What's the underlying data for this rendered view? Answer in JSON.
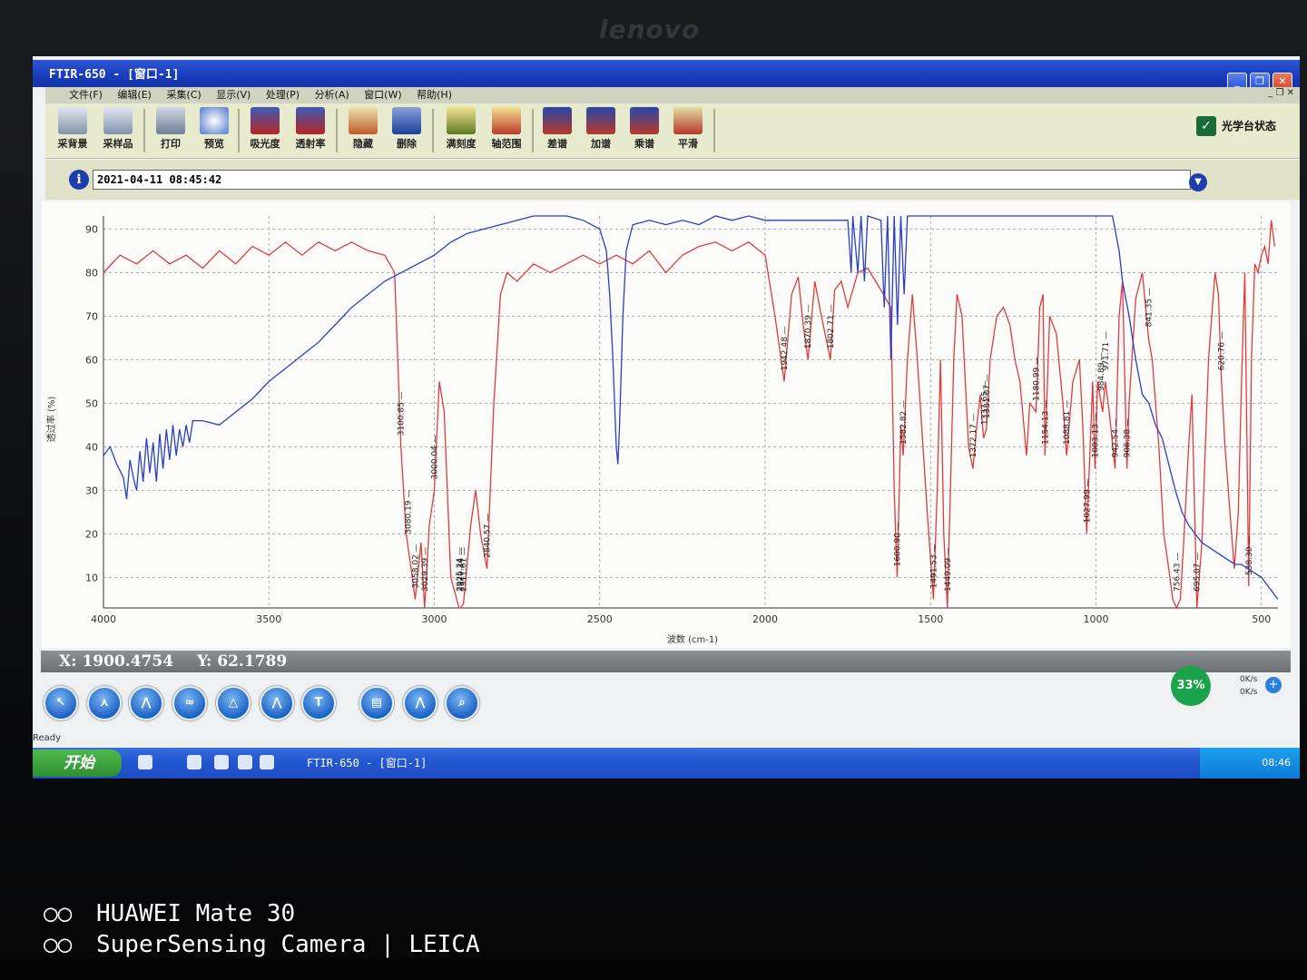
{
  "monitor": {
    "brand": "lenovo"
  },
  "window": {
    "title": "FTIR-650 - [窗口-1]"
  },
  "menu": [
    "文件(F)",
    "编辑(E)",
    "采集(C)",
    "显示(V)",
    "处理(P)",
    "分析(A)",
    "窗口(W)",
    "帮助(H)"
  ],
  "toolbar": {
    "buttons": [
      "采背景",
      "采样品",
      "打印",
      "预览",
      "吸光度",
      "透射率",
      "隐藏",
      "删除",
      "满刻度",
      "轴范围",
      "差谱",
      "加谱",
      "乘谱",
      "平滑"
    ],
    "online_label": "光学台状态"
  },
  "info": {
    "timestamp": "2021-04-11 08:45:42"
  },
  "chart_data": {
    "type": "line",
    "xlabel": "波数 (cm-1)",
    "ylabel": "透过率 (%)",
    "xlim": [
      4000,
      450
    ],
    "ylim": [
      3,
      93
    ],
    "x_ticks": [
      4000,
      3500,
      3000,
      2500,
      2000,
      1500,
      1000,
      500
    ],
    "y_ticks": [
      10,
      20,
      30,
      40,
      50,
      60,
      70,
      80,
      90
    ],
    "grid": true,
    "series": [
      {
        "color": "#e03b3b",
        "points": [
          [
            4000,
            80
          ],
          [
            3950,
            84
          ],
          [
            3900,
            82
          ],
          [
            3850,
            85
          ],
          [
            3800,
            82
          ],
          [
            3750,
            84
          ],
          [
            3700,
            81
          ],
          [
            3650,
            85
          ],
          [
            3600,
            82
          ],
          [
            3550,
            86
          ],
          [
            3500,
            84
          ],
          [
            3450,
            87
          ],
          [
            3400,
            84
          ],
          [
            3350,
            87
          ],
          [
            3300,
            85
          ],
          [
            3250,
            87
          ],
          [
            3200,
            85
          ],
          [
            3150,
            84
          ],
          [
            3120,
            80
          ],
          [
            3100.85,
            40
          ],
          [
            3085,
            20
          ],
          [
            3070,
            12
          ],
          [
            3058.02,
            5
          ],
          [
            3040,
            18
          ],
          [
            3029.39,
            3
          ],
          [
            3015,
            22
          ],
          [
            3000.04,
            30
          ],
          [
            2985,
            55
          ],
          [
            2970,
            48
          ],
          [
            2950,
            10
          ],
          [
            2925,
            3
          ],
          [
            2920.34,
            3
          ],
          [
            2911.61,
            4
          ],
          [
            2890,
            22
          ],
          [
            2875,
            30
          ],
          [
            2860,
            20
          ],
          [
            2840.57,
            12
          ],
          [
            2820,
            50
          ],
          [
            2800,
            75
          ],
          [
            2780,
            80
          ],
          [
            2750,
            78
          ],
          [
            2700,
            82
          ],
          [
            2650,
            80
          ],
          [
            2600,
            82
          ],
          [
            2550,
            84
          ],
          [
            2500,
            82
          ],
          [
            2450,
            84
          ],
          [
            2400,
            82
          ],
          [
            2350,
            85
          ],
          [
            2300,
            80
          ],
          [
            2250,
            84
          ],
          [
            2200,
            86
          ],
          [
            2150,
            87
          ],
          [
            2100,
            85
          ],
          [
            2050,
            87
          ],
          [
            2000,
            84
          ],
          [
            1970,
            70
          ],
          [
            1942.48,
            55
          ],
          [
            1920,
            75
          ],
          [
            1900,
            79
          ],
          [
            1885,
            68
          ],
          [
            1870.39,
            60
          ],
          [
            1850,
            78
          ],
          [
            1830,
            70
          ],
          [
            1802.71,
            60
          ],
          [
            1790,
            76
          ],
          [
            1770,
            78
          ],
          [
            1750,
            72
          ],
          [
            1720,
            80
          ],
          [
            1690,
            81
          ],
          [
            1650,
            76
          ],
          [
            1620,
            72
          ],
          [
            1610,
            30
          ],
          [
            1600.9,
            10
          ],
          [
            1590,
            45
          ],
          [
            1582.82,
            38
          ],
          [
            1570,
            60
          ],
          [
            1555,
            75
          ],
          [
            1540,
            60
          ],
          [
            1510,
            25
          ],
          [
            1491.53,
            5
          ],
          [
            1480,
            30
          ],
          [
            1470,
            60
          ],
          [
            1460,
            20
          ],
          [
            1449.09,
            3
          ],
          [
            1430,
            60
          ],
          [
            1420,
            75
          ],
          [
            1405,
            70
          ],
          [
            1385,
            40
          ],
          [
            1372.17,
            35
          ],
          [
            1360,
            45
          ],
          [
            1350,
            52
          ],
          [
            1340,
            42
          ],
          [
            1331.07,
            44
          ],
          [
            1320,
            60
          ],
          [
            1300,
            70
          ],
          [
            1280,
            72
          ],
          [
            1260,
            68
          ],
          [
            1245,
            60
          ],
          [
            1230,
            55
          ],
          [
            1210,
            38
          ],
          [
            1200,
            50
          ],
          [
            1180.99,
            48
          ],
          [
            1170,
            72
          ],
          [
            1160,
            75
          ],
          [
            1154.13,
            38
          ],
          [
            1140,
            70
          ],
          [
            1120,
            66
          ],
          [
            1100,
            50
          ],
          [
            1088.81,
            38
          ],
          [
            1070,
            55
          ],
          [
            1050,
            60
          ],
          [
            1040,
            45
          ],
          [
            1027.99,
            20
          ],
          [
            1010,
            55
          ],
          [
            1003.13,
            35
          ],
          [
            995,
            55
          ],
          [
            980,
            48
          ],
          [
            971.71,
            55
          ],
          [
            960,
            48
          ],
          [
            942.54,
            35
          ],
          [
            930,
            70
          ],
          [
            920,
            78
          ],
          [
            906.38,
            35
          ],
          [
            900,
            50
          ],
          [
            880,
            74
          ],
          [
            860,
            80
          ],
          [
            841.35,
            65
          ],
          [
            830,
            60
          ],
          [
            810,
            40
          ],
          [
            795,
            20
          ],
          [
            780,
            12
          ],
          [
            768,
            5
          ],
          [
            756.43,
            3
          ],
          [
            745,
            5
          ],
          [
            735,
            18
          ],
          [
            720,
            40
          ],
          [
            710,
            52
          ],
          [
            695.07,
            3
          ],
          [
            680,
            18
          ],
          [
            660,
            60
          ],
          [
            640,
            80
          ],
          [
            630,
            75
          ],
          [
            620.76,
            55
          ],
          [
            610,
            40
          ],
          [
            595,
            25
          ],
          [
            582,
            12
          ],
          [
            570,
            25
          ],
          [
            560,
            55
          ],
          [
            550,
            80
          ],
          [
            538.3,
            8
          ],
          [
            530,
            60
          ],
          [
            520,
            82
          ],
          [
            510,
            80
          ],
          [
            500,
            84
          ],
          [
            490,
            86
          ],
          [
            480,
            82
          ],
          [
            470,
            92
          ],
          [
            460,
            86
          ]
        ]
      },
      {
        "color": "#2b3fc6",
        "points": [
          [
            4000,
            38
          ],
          [
            3980,
            40
          ],
          [
            3960,
            36
          ],
          [
            3940,
            33
          ],
          [
            3930,
            28
          ],
          [
            3920,
            37
          ],
          [
            3910,
            33
          ],
          [
            3900,
            30
          ],
          [
            3890,
            39
          ],
          [
            3880,
            32
          ],
          [
            3870,
            42
          ],
          [
            3860,
            34
          ],
          [
            3850,
            41
          ],
          [
            3840,
            32
          ],
          [
            3830,
            43
          ],
          [
            3820,
            35
          ],
          [
            3810,
            44
          ],
          [
            3800,
            37
          ],
          [
            3790,
            45
          ],
          [
            3780,
            38
          ],
          [
            3770,
            44
          ],
          [
            3760,
            40
          ],
          [
            3750,
            45
          ],
          [
            3740,
            41
          ],
          [
            3730,
            46
          ],
          [
            3700,
            46
          ],
          [
            3650,
            45
          ],
          [
            3600,
            48
          ],
          [
            3550,
            51
          ],
          [
            3500,
            55
          ],
          [
            3450,
            58
          ],
          [
            3400,
            61
          ],
          [
            3350,
            64
          ],
          [
            3300,
            68
          ],
          [
            3250,
            72
          ],
          [
            3200,
            75
          ],
          [
            3150,
            78
          ],
          [
            3100,
            80
          ],
          [
            3050,
            82
          ],
          [
            3000,
            84
          ],
          [
            2950,
            87
          ],
          [
            2900,
            89
          ],
          [
            2800,
            91
          ],
          [
            2700,
            93
          ],
          [
            2600,
            93
          ],
          [
            2550,
            92
          ],
          [
            2500,
            90
          ],
          [
            2480,
            85
          ],
          [
            2470,
            75
          ],
          [
            2460,
            60
          ],
          [
            2450,
            40
          ],
          [
            2445,
            36
          ],
          [
            2440,
            45
          ],
          [
            2430,
            70
          ],
          [
            2420,
            85
          ],
          [
            2400,
            91
          ],
          [
            2350,
            92
          ],
          [
            2300,
            91
          ],
          [
            2250,
            92
          ],
          [
            2200,
            91
          ],
          [
            2150,
            93
          ],
          [
            2100,
            92
          ],
          [
            2050,
            93
          ],
          [
            2000,
            92
          ],
          [
            1900,
            92
          ],
          [
            1800,
            92
          ],
          [
            1750,
            92
          ],
          [
            1740,
            80
          ],
          [
            1735,
            93
          ],
          [
            1720,
            80
          ],
          [
            1710,
            93
          ],
          [
            1700,
            78
          ],
          [
            1690,
            93
          ],
          [
            1650,
            92
          ],
          [
            1640,
            72
          ],
          [
            1630,
            93
          ],
          [
            1620,
            60
          ],
          [
            1610,
            93
          ],
          [
            1600,
            68
          ],
          [
            1590,
            93
          ],
          [
            1580,
            75
          ],
          [
            1570,
            93
          ],
          [
            1500,
            93
          ],
          [
            1400,
            93
          ],
          [
            1300,
            93
          ],
          [
            1200,
            93
          ],
          [
            1100,
            93
          ],
          [
            1000,
            93
          ],
          [
            950,
            93
          ],
          [
            930,
            85
          ],
          [
            920,
            78
          ],
          [
            900,
            70
          ],
          [
            880,
            60
          ],
          [
            860,
            52
          ],
          [
            840,
            50
          ],
          [
            820,
            45
          ],
          [
            800,
            42
          ],
          [
            780,
            36
          ],
          [
            760,
            30
          ],
          [
            740,
            25
          ],
          [
            720,
            22
          ],
          [
            700,
            20
          ],
          [
            680,
            18
          ],
          [
            660,
            17
          ],
          [
            640,
            16
          ],
          [
            620,
            15
          ],
          [
            600,
            14
          ],
          [
            580,
            13
          ],
          [
            560,
            13
          ],
          [
            540,
            12
          ],
          [
            520,
            11
          ],
          [
            500,
            10
          ],
          [
            480,
            8
          ],
          [
            460,
            6
          ],
          [
            450,
            5
          ]
        ]
      }
    ],
    "peak_labels": [
      {
        "x": 3100.85,
        "label": "3100.85"
      },
      {
        "x": 3080.19,
        "label": "3080.19"
      },
      {
        "x": 3058.02,
        "label": "3058.02"
      },
      {
        "x": 3029.39,
        "label": "3029.39"
      },
      {
        "x": 3000.04,
        "label": "3000.04"
      },
      {
        "x": 2925.24,
        "label": "2925.24"
      },
      {
        "x": 2920.34,
        "label": "2920.34"
      },
      {
        "x": 2911.61,
        "label": "2911.61"
      },
      {
        "x": 2840.57,
        "label": "2840.57"
      },
      {
        "x": 1942.48,
        "label": "1942.48"
      },
      {
        "x": 1870.39,
        "label": "1870.39"
      },
      {
        "x": 1802.71,
        "label": "1802.71"
      },
      {
        "x": 1600.9,
        "label": "1600.90"
      },
      {
        "x": 1582.82,
        "label": "1582.82"
      },
      {
        "x": 1491.53,
        "label": "1491.53"
      },
      {
        "x": 1449.09,
        "label": "1449.09"
      },
      {
        "x": 1372.17,
        "label": "1372.17"
      },
      {
        "x": 1337.65,
        "label": "1337.65"
      },
      {
        "x": 1331.07,
        "label": "1331.07"
      },
      {
        "x": 1180.99,
        "label": "1180.99"
      },
      {
        "x": 1154.13,
        "label": "1154.13"
      },
      {
        "x": 1088.81,
        "label": "1088.81"
      },
      {
        "x": 1027.99,
        "label": "1027.99"
      },
      {
        "x": 1003.13,
        "label": "1003.13"
      },
      {
        "x": 984.89,
        "label": "984.89"
      },
      {
        "x": 971.71,
        "label": "971.71"
      },
      {
        "x": 942.54,
        "label": "942.54"
      },
      {
        "x": 906.38,
        "label": "906.38"
      },
      {
        "x": 841.35,
        "label": "841.35"
      },
      {
        "x": 756.43,
        "label": "756.43"
      },
      {
        "x": 695.07,
        "label": "695.07"
      },
      {
        "x": 620.76,
        "label": "620.76"
      },
      {
        "x": 538.3,
        "label": "538.30"
      }
    ]
  },
  "cursor_readout": {
    "x_label": "X:",
    "x_value": "1900.4754",
    "y_label": "Y:",
    "y_value": "62.1789"
  },
  "bottom_tools": [
    "pointer-tool",
    "peak-pick-tool",
    "baseline-tool",
    "spectrum-tool",
    "peak-area-tool",
    "peak-height-tool",
    "text-tool",
    "library-tool",
    "chart-tool",
    "zoom-tool"
  ],
  "text_tool_glyph": "T",
  "network": {
    "percent": "33%",
    "up": "0K/s",
    "down": "0K/s"
  },
  "status": "Ready",
  "taskbar": {
    "start": "开始",
    "task": "FTIR-650 - [窗口-1]",
    "clock": "08:46"
  },
  "camera": {
    "line1": "HUAWEI Mate 30",
    "line2": "SuperSensing Camera | LEICA"
  }
}
